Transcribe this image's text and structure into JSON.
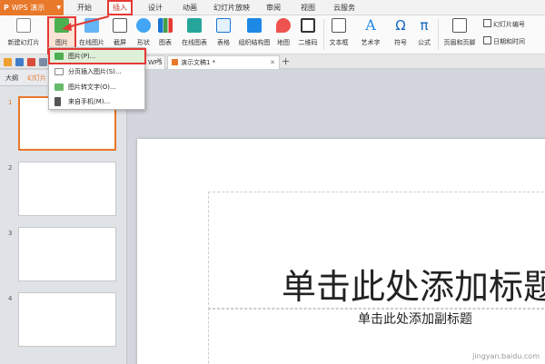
{
  "app": {
    "name": "WPS 演示"
  },
  "menu_tabs": [
    "开始",
    "插入",
    "设计",
    "动画",
    "幻灯片放映",
    "审阅",
    "视图",
    "云服务"
  ],
  "active_menu": "插入",
  "ribbon": {
    "new_slide": "新建幻灯片",
    "picture": "图片",
    "online_picture": "在线图片",
    "screenshot": "截屏",
    "shape": "形状",
    "chart": "图表",
    "online_chart": "在线图表",
    "table": "表格",
    "smartart": "组织结构图",
    "map": "地图",
    "qrcode": "二维码",
    "textbox": "文本框",
    "wordart": "艺术字",
    "symbol": "符号",
    "formula": "公式",
    "header_footer": "页眉和页脚",
    "slide_number": "幻灯片编号",
    "date_time": "日期和时间"
  },
  "tabs": {
    "partial_tab": "WPS",
    "doc_tab": "演示文稿1 *"
  },
  "left_panel": {
    "tab_outline": "大纲",
    "tab_slides": "幻灯片"
  },
  "slide_numbers": [
    "1",
    "2",
    "3",
    "4"
  ],
  "slide": {
    "title": "单击此处添加标题",
    "subtitle": "单击此处添加副标题"
  },
  "dropdown": {
    "items": [
      "图片(P)...",
      "分页插入图片(S)...",
      "图片转文字(O)...",
      "来自手机(M)..."
    ]
  },
  "watermark": "jingyan.baidu.com",
  "colors": {
    "accent": "#e8782a",
    "highlight": "#e53935"
  }
}
